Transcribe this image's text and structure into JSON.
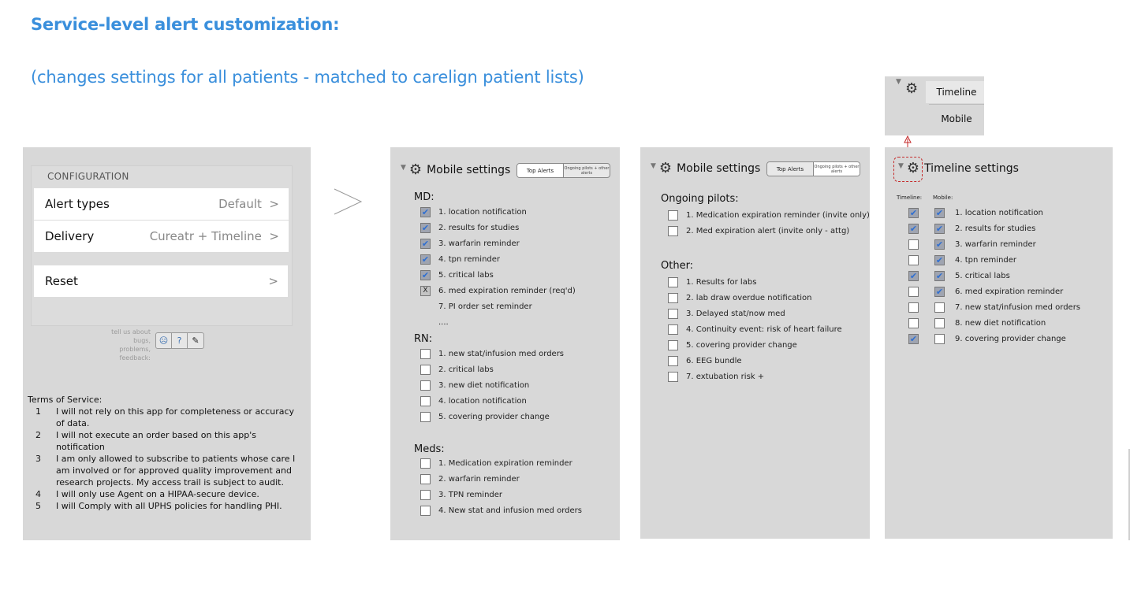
{
  "page": {
    "heading": "Service-level alert customization:",
    "subheading": "(changes settings for all patients - matched to carelign patient lists)"
  },
  "config": {
    "title": "CONFIGURATION",
    "alert_types_label": "Alert types",
    "alert_types_value": "Default",
    "delivery_label": "Delivery",
    "delivery_value": "Cureatr + Timeline",
    "reset_label": "Reset",
    "chevron": ">",
    "help_text": "tell us about bugs, problems, feedback:",
    "help_buttons": {
      "sad": "☹",
      "question": "?",
      "edit": "✎"
    },
    "tos_title": "Terms of Service:",
    "tos": [
      {
        "n": "1",
        "text": "I will not rely on this app for completeness or accuracy of data."
      },
      {
        "n": "2",
        "text": "I will not execute an order based on this app's notification"
      },
      {
        "n": "3",
        "text": "I am only allowed to subscribe to patients whose care I am involved or for approved quality improvement and research projects. My access trail is subject to audit."
      },
      {
        "n": "4",
        "text": "I will only use Agent on a HIPAA-secure device."
      },
      {
        "n": "5",
        "text": "I will Comply with all UPHS policies for handling PHI."
      }
    ]
  },
  "mobile": {
    "title": "Mobile settings",
    "seg_on": "Top Alerts",
    "seg_off": "Ongoing pilots + other alerts",
    "md_label": "MD:",
    "md_items": [
      {
        "label": "1. location notification",
        "state": "checked"
      },
      {
        "label": "2. results for studies",
        "state": "checked"
      },
      {
        "label": "3. warfarin reminder",
        "state": "checked"
      },
      {
        "label": "4. tpn reminder",
        "state": "checked"
      },
      {
        "label": "5. critical labs",
        "state": "checked"
      },
      {
        "label": "6. med expiration reminder (req'd)",
        "state": "x"
      },
      {
        "label": "7. PI order set reminder",
        "state": "none"
      },
      {
        "label": "....",
        "state": "none"
      }
    ],
    "rn_label": "RN:",
    "rn_items": [
      {
        "label": "1. new stat/infusion med orders",
        "state": "unchecked"
      },
      {
        "label": "2. critical labs",
        "state": "unchecked"
      },
      {
        "label": "3. new diet notification",
        "state": "unchecked"
      },
      {
        "label": "4. location notification",
        "state": "unchecked"
      },
      {
        "label": "5. covering provider change",
        "state": "unchecked"
      }
    ],
    "meds_label": "Meds:",
    "meds_items": [
      {
        "label": "1. Medication expiration reminder",
        "state": "unchecked"
      },
      {
        "label": "2. warfarin reminder",
        "state": "unchecked"
      },
      {
        "label": "3. TPN reminder",
        "state": "unchecked"
      },
      {
        "label": "4. New stat and infusion med orders",
        "state": "unchecked"
      }
    ]
  },
  "mobile2": {
    "title": "Mobile settings",
    "seg_on": "Top Alerts",
    "seg_off": "Ongoing pilots + other alerts",
    "ongoing_label": "Ongoing pilots:",
    "ongoing_items": [
      {
        "label": "1. Medication expiration reminder (invite only)",
        "state": "unchecked"
      },
      {
        "label": "2. Med expiration alert (invite only - attg)",
        "state": "unchecked"
      }
    ],
    "other_label": "Other:",
    "other_items": [
      {
        "label": "1. Results for labs",
        "state": "unchecked"
      },
      {
        "label": "2. lab draw overdue notification",
        "state": "unchecked"
      },
      {
        "label": "3. Delayed stat/now med",
        "state": "unchecked"
      },
      {
        "label": "4. Continuity event: risk of heart failure",
        "state": "unchecked"
      },
      {
        "label": "5. covering provider change",
        "state": "unchecked"
      },
      {
        "label": "6. EEG bundle",
        "state": "unchecked"
      },
      {
        "label": "7. extubation risk +",
        "state": "unchecked"
      }
    ]
  },
  "timeline": {
    "title": "Timeline settings",
    "col_timeline": "Timeline:",
    "col_mobile": "Mobile:",
    "items": [
      {
        "label": "1. location notification",
        "timeline": "checked",
        "mobile": "checked"
      },
      {
        "label": "2. results for studies",
        "timeline": "checked",
        "mobile": "checked"
      },
      {
        "label": "3. warfarin reminder",
        "timeline": "unchecked",
        "mobile": "checked"
      },
      {
        "label": "4. tpn reminder",
        "timeline": "unchecked",
        "mobile": "checked"
      },
      {
        "label": "5. critical labs",
        "timeline": "checked",
        "mobile": "checked"
      },
      {
        "label": "6. med expiration reminder",
        "timeline": "unchecked",
        "mobile": "checked"
      },
      {
        "label": "7. new stat/infusion med orders",
        "timeline": "unchecked",
        "mobile": "unchecked"
      },
      {
        "label": "8. new diet notification",
        "timeline": "unchecked",
        "mobile": "unchecked"
      },
      {
        "label": "9. covering provider change",
        "timeline": "checked",
        "mobile": "unchecked"
      }
    ]
  },
  "dropdown": {
    "options": [
      "Timeline",
      "Mobile"
    ],
    "selected": "Timeline"
  },
  "colors": {
    "heading": "#3a8fdc",
    "panel": "#d8d8d8",
    "check": "#2f6fd1",
    "annotation": "#c52a2a"
  },
  "icons": {
    "gear": "gear-icon",
    "disclosure": "disclosure-triangle-icon",
    "chevron": "chevron-right-icon"
  }
}
